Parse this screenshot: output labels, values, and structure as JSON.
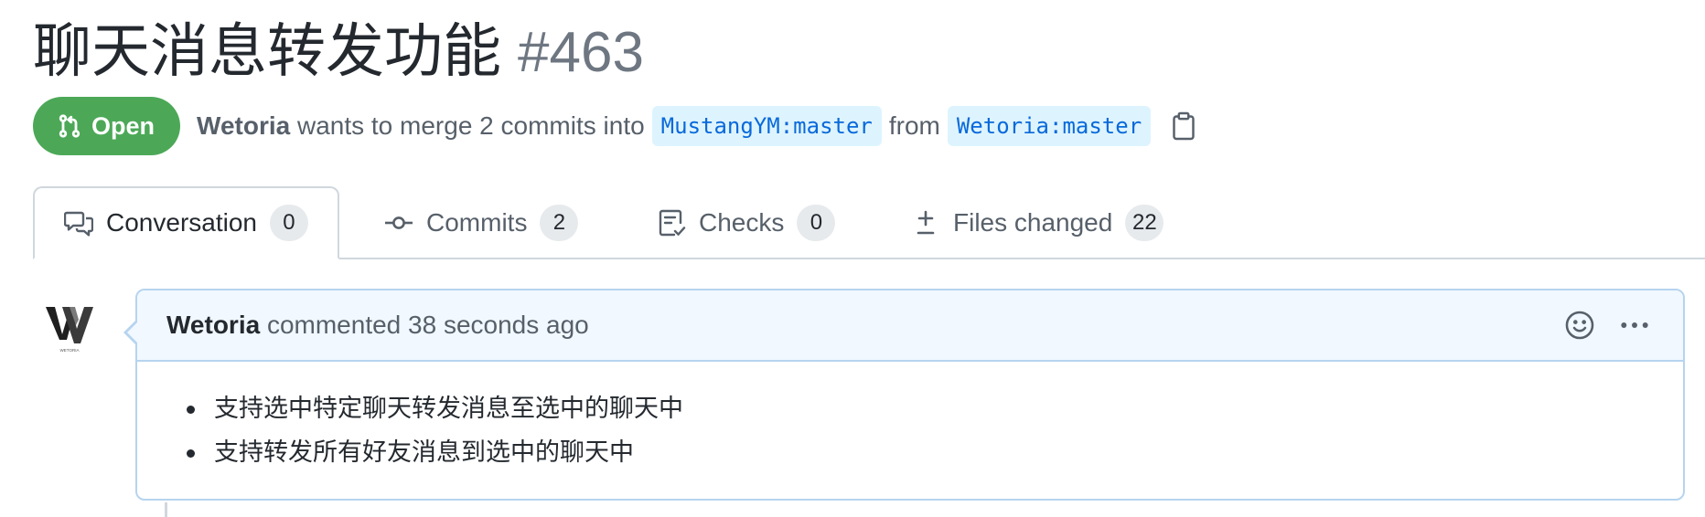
{
  "pr": {
    "title": "聊天消息转发功能",
    "number": "#463",
    "state": "Open",
    "author": "Wetoria",
    "merge_text": "wants to merge 2 commits into",
    "base_branch": "MustangYM:master",
    "from_text": "from",
    "head_branch": "Wetoria:master"
  },
  "tabs": [
    {
      "label": "Conversation",
      "count": "0",
      "icon": "comment-discussion-icon"
    },
    {
      "label": "Commits",
      "count": "2",
      "icon": "git-commit-icon"
    },
    {
      "label": "Checks",
      "count": "0",
      "icon": "checklist-icon"
    },
    {
      "label": "Files changed",
      "count": "22",
      "icon": "file-diff-icon"
    }
  ],
  "comment": {
    "author": "Wetoria",
    "action": "commented",
    "time": "38 seconds ago",
    "body": [
      "支持选中特定聊天转发消息至选中的聊天中",
      "支持转发所有好友消息到选中的聊天中"
    ]
  },
  "avatar": {
    "letters": "W",
    "caption": "WETORIA"
  },
  "colors": {
    "open_green": "#4ca857",
    "link_blue": "#0969da",
    "branch_bg": "#ddf4ff",
    "comment_header_bg": "#f1f8ff",
    "comment_border": "#b6d4ef"
  }
}
